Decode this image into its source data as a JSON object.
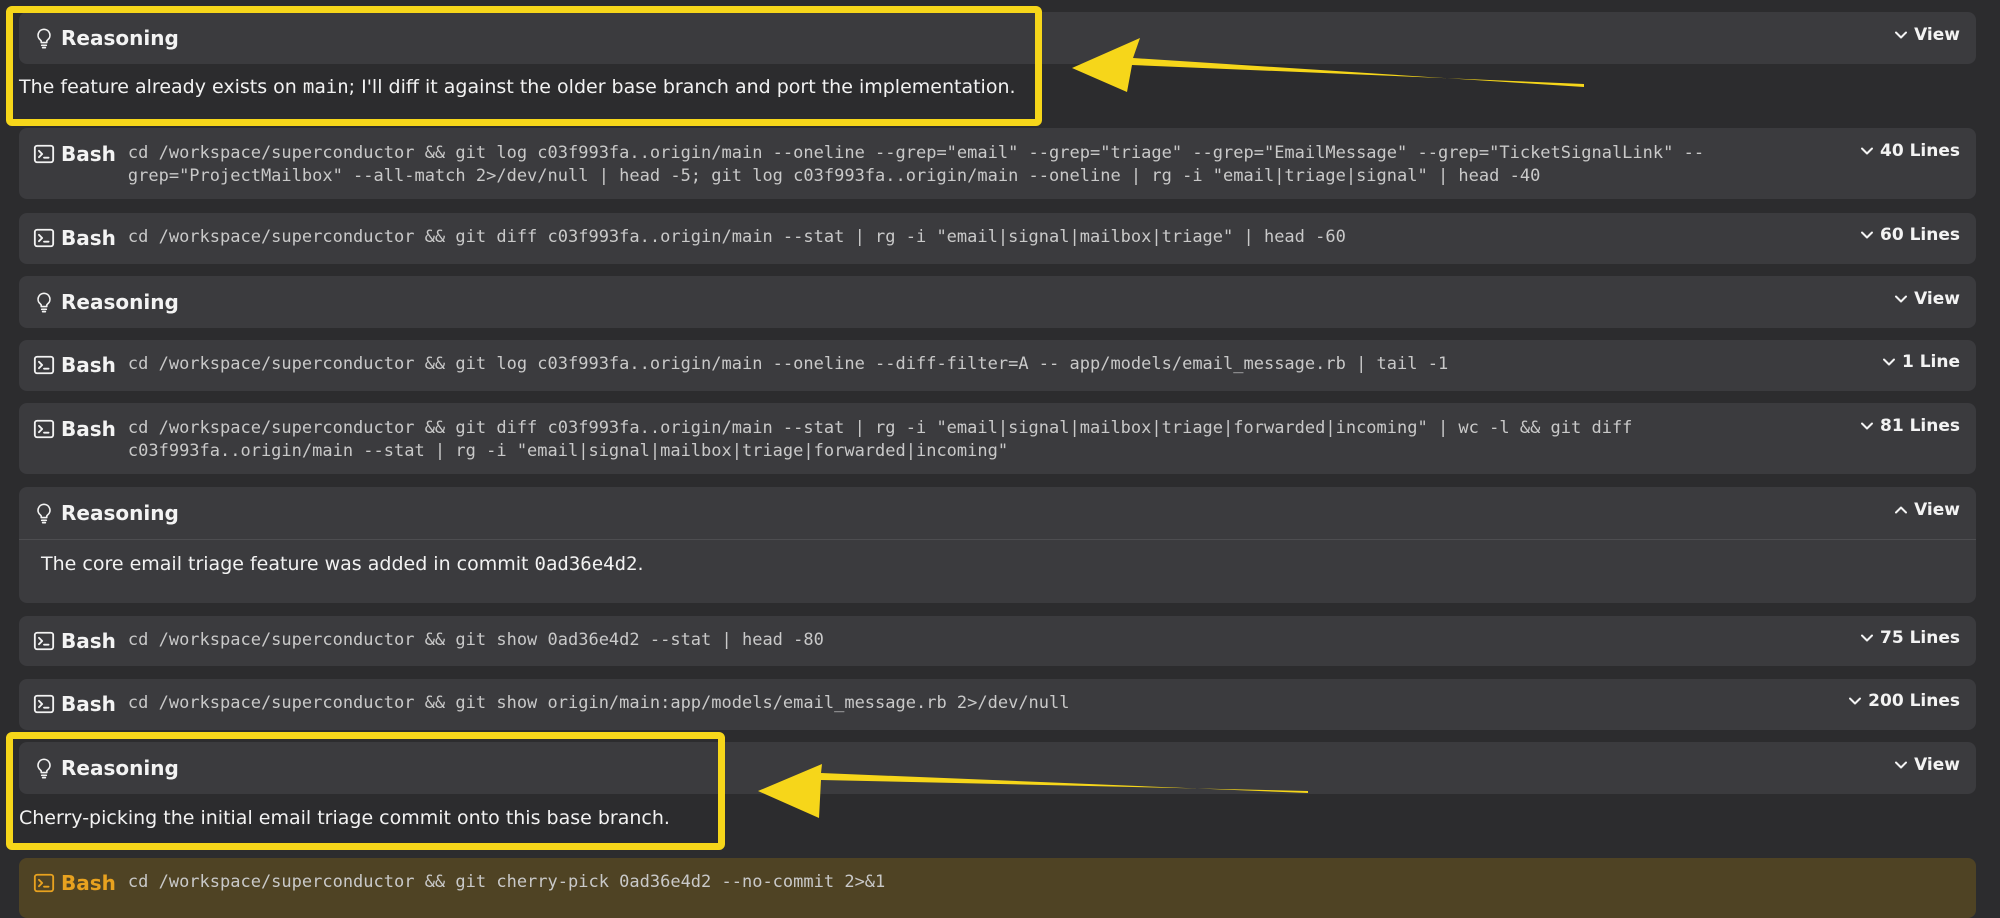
{
  "rows": [
    {
      "type": "reasoning",
      "label": "Reasoning",
      "right": "View",
      "chevron": "down"
    },
    {
      "type": "bash",
      "label": "Bash",
      "command": "cd /workspace/superconductor && git log c03f993fa..origin/main --oneline --grep=\"email\" --grep=\"triage\" --grep=\"EmailMessage\" --grep=\"TicketSignalLink\" --\ngrep=\"ProjectMailbox\" --all-match 2>/dev/null | head -5; git log c03f993fa..origin/main --oneline | rg -i \"email|triage|signal\" | head -40",
      "right": "40 Lines"
    },
    {
      "type": "bash",
      "label": "Bash",
      "command": "cd /workspace/superconductor && git diff c03f993fa..origin/main --stat | rg -i \"email|signal|mailbox|triage\" | head -60",
      "right": "60 Lines"
    },
    {
      "type": "reasoning",
      "label": "Reasoning",
      "right": "View",
      "chevron": "down"
    },
    {
      "type": "bash",
      "label": "Bash",
      "command": "cd /workspace/superconductor && git log c03f993fa..origin/main --oneline --diff-filter=A -- app/models/email_message.rb | tail -1",
      "right": "1 Line"
    },
    {
      "type": "bash",
      "label": "Bash",
      "command": "cd /workspace/superconductor && git diff c03f993fa..origin/main --stat | rg -i \"email|signal|mailbox|triage|forwarded|incoming\" | wc -l && git diff\nc03f993fa..origin/main --stat | rg -i \"email|signal|mailbox|triage|forwarded|incoming\"",
      "right": "81 Lines"
    },
    {
      "type": "reasoning",
      "label": "Reasoning",
      "right": "View",
      "chevron": "up"
    },
    {
      "type": "bash",
      "label": "Bash",
      "command": "cd /workspace/superconductor && git show 0ad36e4d2 --stat | head -80",
      "right": "75 Lines"
    },
    {
      "type": "bash",
      "label": "Bash",
      "command": "cd /workspace/superconductor && git show origin/main:app/models/email_message.rb 2>/dev/null",
      "right": "200 Lines"
    },
    {
      "type": "reasoning",
      "label": "Reasoning",
      "right": "View",
      "chevron": "down"
    },
    {
      "type": "bash",
      "label": "Bash",
      "command": "cd /workspace/superconductor && git cherry-pick 0ad36e4d2 --no-commit 2>&1",
      "right": ""
    }
  ],
  "text1": {
    "before": "The feature already exists on ",
    "code": "main",
    "after": "; I'll diff it against the older base branch and port the implementation."
  },
  "expanded": {
    "before": "The core email triage feature was added in commit ",
    "code": "0ad36e4d2",
    "after": "."
  },
  "text2": "Cherry-picking the initial email triage commit onto this base branch.",
  "colors": {
    "background": "#2c2c2e",
    "row": "#3b3b3e",
    "active_row": "#4f4324",
    "highlight": "#f6d61a",
    "accent": "#e8a21f"
  }
}
